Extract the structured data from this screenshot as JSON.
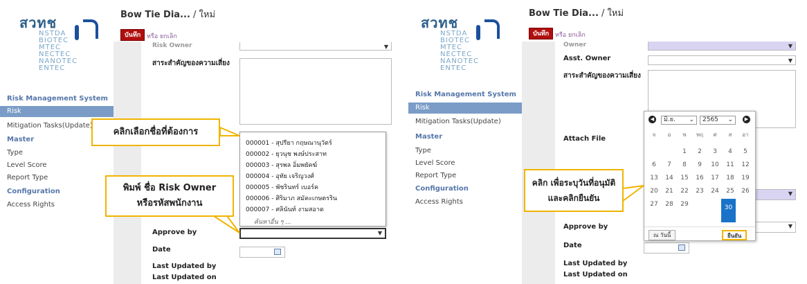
{
  "logo": {
    "main": "สวทช",
    "sub": [
      "NSTDA",
      "BIOTEC",
      "MTEC",
      "NECTEC",
      "NANOTEC",
      "ENTEC"
    ]
  },
  "left": {
    "breadcrumb": "Bow Tie Dia...",
    "breadcrumb_sep": "/ ใหม่",
    "save": "บันทึก",
    "or_cancel": "หรือ ยกเลิก",
    "sidebar": {
      "group_main": "Risk Management System",
      "risk": "Risk",
      "mitigation": "Mitigation Tasks(Update)",
      "master": "Master",
      "type": "Type",
      "level_score": "Level Score",
      "report_type": "Report Type",
      "configuration": "Configuration",
      "access_rights": "Access Rights"
    },
    "fields": {
      "risk_owner_top": "Risk Owner",
      "importance": "สาระสำคัญของความเสี่ยง",
      "approve_by": "Approve by",
      "date": "Date",
      "last_updated_by": "Last Updated by",
      "last_updated_on": "Last Updated on"
    },
    "dropdown": [
      "000001 - สุปรียา กฤษณานุวัตร์",
      "000002 - ยุวนุช พงษ์ประสาท",
      "000003 - สุรพล อิ่มพยัคฆ์",
      "000004 - อุทัย เจริญวงศ์",
      "000005 - พัชรินทร์ เบอร์ค",
      "000006 - ศิริมาภ สมัคะเกษตรริน",
      "000007 - ศลินันท์ งามสอาด"
    ],
    "dropdown_more": "ค้นหาอื่น ๆ ...",
    "callout1": "คลิกเลือกชื่อที่ต้องการ",
    "callout2_line1": "พิมพ์ ชื่อ Risk Owner",
    "callout2_line2": "หรือรหัสพนักงาน"
  },
  "right": {
    "breadcrumb": "Bow Tie Dia...",
    "breadcrumb_sep": "/ ใหม่",
    "save": "บันทึก",
    "or_cancel": "หรือ ยกเลิก",
    "fields": {
      "owner_top": "Owner",
      "asst_owner": "Asst. Owner",
      "importance": "สาระสำคัญของความเสี่ยง",
      "attach_file": "Attach File",
      "approve_by": "Approve by",
      "date": "Date",
      "last_updated_by": "Last Updated by",
      "last_updated_on": "Last Updated on"
    },
    "calendar": {
      "prev": "◀",
      "next": "▶",
      "month": "มิ.ย.",
      "year": "2565",
      "dow": [
        "จ",
        "อ",
        "พ",
        "พฤ",
        "ศ",
        "ส",
        "อา"
      ],
      "today_btn": "ณ วันนี้",
      "ok_btn": "ยืนยัน",
      "selected": "30"
    },
    "callout_line1": "คลิก เพื่อระบุวันที่อนุมัติ",
    "callout_line2": "และคลิกยืนยัน"
  }
}
